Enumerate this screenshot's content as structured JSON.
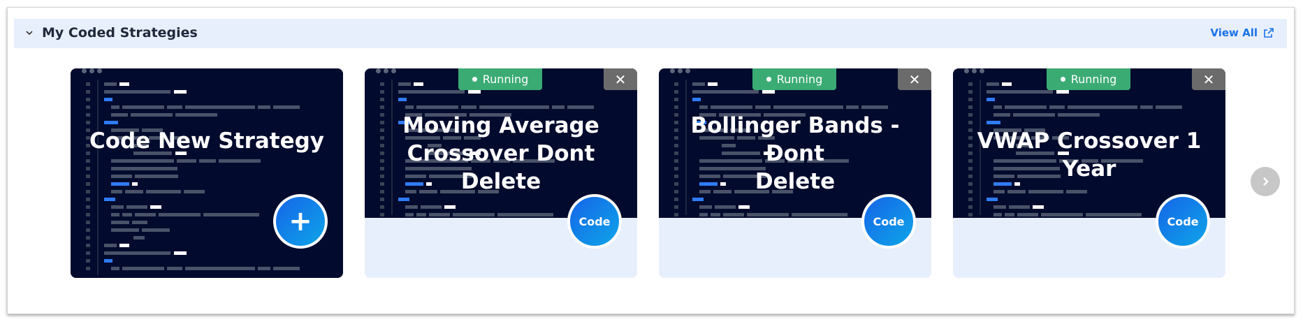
{
  "section": {
    "title": "My Coded Strategies",
    "view_all_label": "View All"
  },
  "new_card": {
    "title": "Code New Strategy",
    "button_symbol": "+"
  },
  "strategies": [
    {
      "title_line1": "Moving Average",
      "title_line2": "Crossover Dont Delete",
      "status": "Running",
      "button_label": "Code",
      "close_symbol": "✕"
    },
    {
      "title_line1": "Bollinger Bands - Dont",
      "title_line2": "Delete",
      "status": "Running",
      "button_label": "Code",
      "close_symbol": "✕"
    },
    {
      "title_line1": "VWAP Crossover 1 Year",
      "title_line2": "",
      "status": "Running",
      "button_label": "Code",
      "close_symbol": "✕"
    }
  ],
  "colors": {
    "header_bg": "#e8effc",
    "card_dark": "#020b2d",
    "running_green": "#3bab74",
    "link_blue": "#1a73e8",
    "code_button_from": "#1565e8",
    "code_button_to": "#0ea5e9"
  },
  "icons": {
    "collapse": "chevron-down-icon",
    "view_all": "external-link-icon",
    "next": "chevron-right-icon",
    "close": "close-icon",
    "add": "plus-icon"
  }
}
